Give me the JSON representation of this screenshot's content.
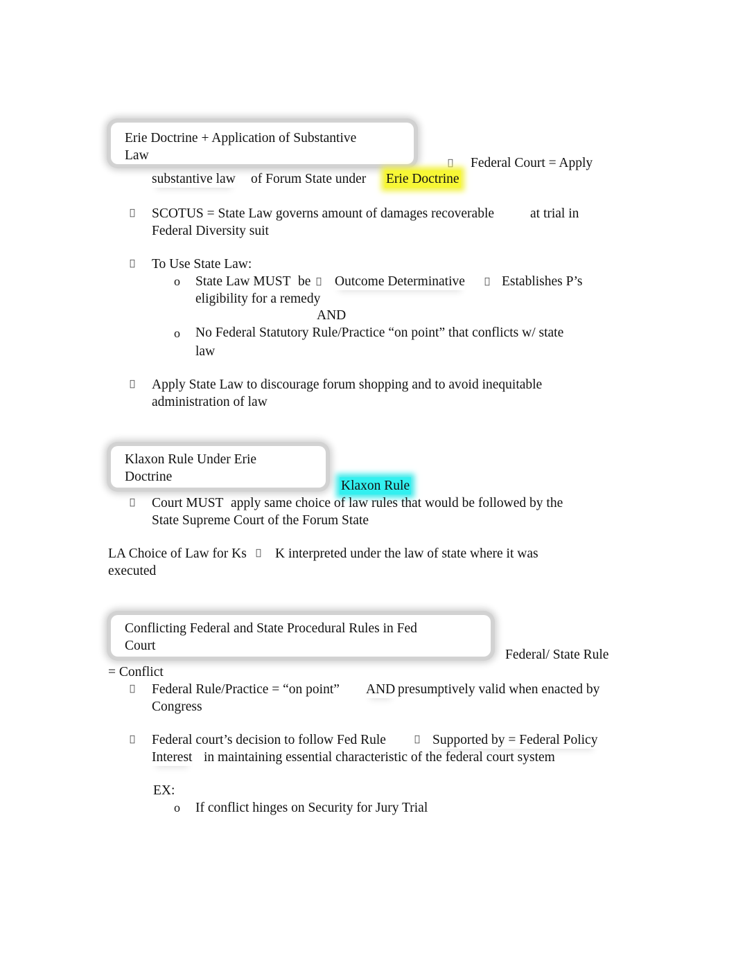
{
  "sections": [
    {
      "title": "Erie Doctrine + Application of Substantive Law",
      "title_lines": [
        "Erie Doctrine + Application of Substantive",
        "Law"
      ],
      "intro": {
        "bullet": "",
        "part1": "Federal Court = Apply",
        "part2a": "substantive law",
        "part2b": "of Forum State under",
        "highlight": "Erie Doctrine",
        "highlight_color": "#f7f736"
      },
      "items": [
        {
          "bullet": "",
          "line1a": "SCOTUS = State Law governs amount of damages recoverable",
          "line1b": "at trial in",
          "line2": "Federal Diversity suit"
        },
        {
          "bullet": "",
          "line1": "To Use State Law:",
          "sub": [
            {
              "marker": "o",
              "a": "State Law MUST",
              "b": "be",
              "arrow1": "",
              "c": "Outcome Determinative",
              "arrow2": "",
              "d": "Establishes P’s",
              "line2": "eligibility for a remedy"
            },
            {
              "connector": "AND"
            },
            {
              "marker": "o",
              "line1": "No Federal Statutory Rule/Practice “on point” that conflicts w/ state",
              "line2": "law"
            }
          ]
        },
        {
          "bullet": "",
          "line1": "Apply State Law to discourage forum shopping and to avoid inequitable",
          "line2": "administration of law"
        }
      ]
    },
    {
      "title": "Klaxon Rule Under Erie Doctrine",
      "title_lines": [
        "Klaxon Rule Under Erie",
        "Doctrine"
      ],
      "highlight": "Klaxon Rule",
      "highlight_color": "#33f0f0",
      "items": [
        {
          "bullet": "",
          "line1a": "Court MUST",
          "line1b": "apply same choice of law rules that would be followed by the",
          "line2": "State Supreme Court of the Forum State"
        }
      ],
      "note": {
        "line1a": "LA Choice of Law for Ks",
        "arrow": "",
        "line1b": "K interpreted under the law of state where it was",
        "line2": "executed"
      }
    },
    {
      "title": "Conflicting Federal and State Procedural Rules in Fed Court",
      "title_lines": [
        "Conflicting Federal and State Procedural Rules in Fed",
        "Court"
      ],
      "intro": {
        "part1": "Federal/ State Rule",
        "part2": "= Conflict"
      },
      "items": [
        {
          "bullet": "",
          "line1a": "Federal Rule/Practice = “on point”",
          "line1b": "AND",
          "line1c": "presumptively valid when enacted by",
          "line2": "Congress"
        },
        {
          "bullet": "",
          "line1a": "Federal court’s decision to follow Fed Rule",
          "arrow": "",
          "line1b": "Supported by = Federal Policy",
          "line2a": "Interest",
          "line2b": "in maintaining essential characteristic of the federal court system"
        }
      ],
      "example": {
        "label": "EX:",
        "marker": "o",
        "text": "If conflict hinges on Security for Jury Trial"
      }
    }
  ]
}
